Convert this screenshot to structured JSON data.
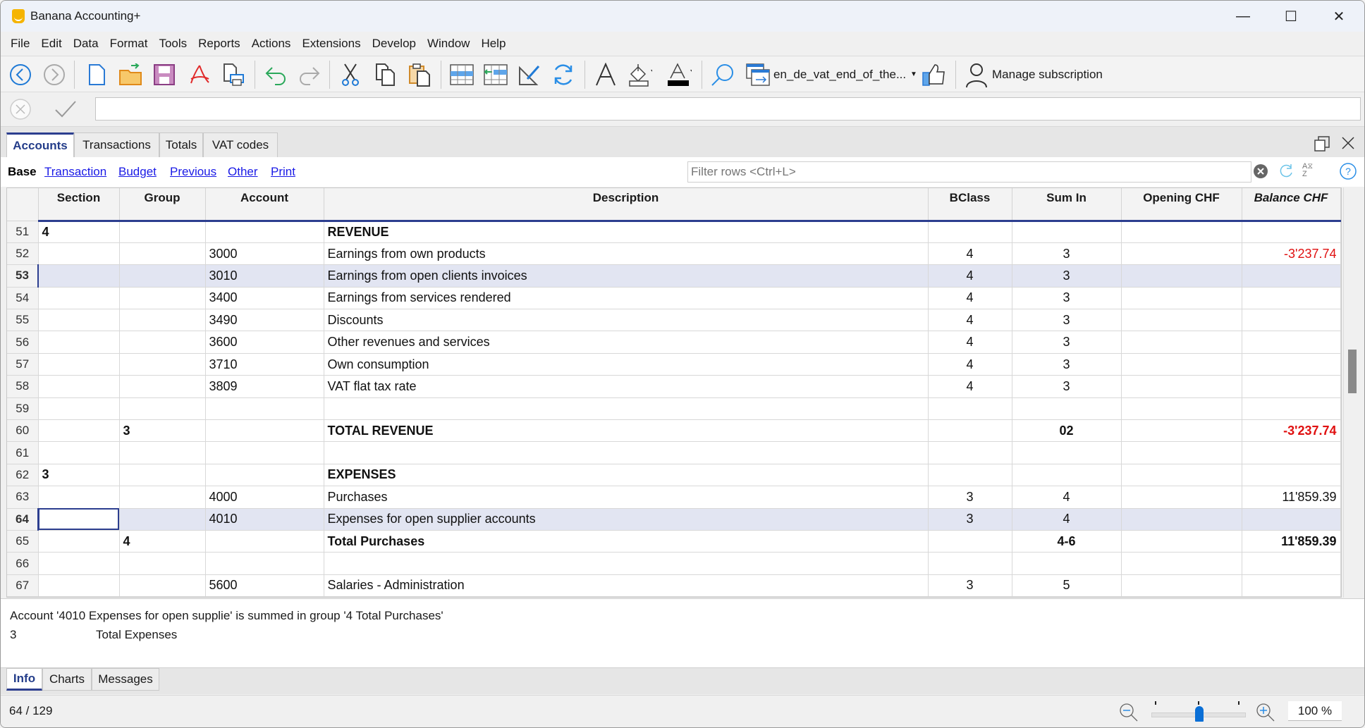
{
  "window": {
    "title": "Banana Accounting+",
    "minimize": "—",
    "maximize": "☐",
    "close": "✕"
  },
  "menu": [
    "File",
    "Edit",
    "Data",
    "Format",
    "Tools",
    "Reports",
    "Actions",
    "Extensions",
    "Develop",
    "Window",
    "Help"
  ],
  "toolbar": {
    "file_selector": "en_de_vat_end_of_the...",
    "manage_subscription": "Manage subscription"
  },
  "editbar": {
    "value": ""
  },
  "tables_tabs": [
    {
      "label": "Accounts",
      "active": true
    },
    {
      "label": "Transactions",
      "active": false
    },
    {
      "label": "Totals",
      "active": false
    },
    {
      "label": "VAT codes",
      "active": false
    }
  ],
  "views": {
    "active": "Base",
    "links": [
      "Transaction",
      "Budget",
      "Previous",
      "Other",
      "Print"
    ]
  },
  "filter": {
    "placeholder": "Filter rows <Ctrl+L>",
    "value": ""
  },
  "columns": [
    "Section",
    "Group",
    "Account",
    "Description",
    "BClass",
    "Sum In",
    "Opening CHF",
    "Balance CHF"
  ],
  "rows": [
    {
      "n": "51",
      "section": "4",
      "group": "",
      "account": "",
      "desc": "REVENUE",
      "bclass": "",
      "sumin": "",
      "opening": "",
      "balance": "",
      "bold": true
    },
    {
      "n": "52",
      "section": "",
      "group": "",
      "account": "3000",
      "desc": "Earnings from own products",
      "bclass": "4",
      "sumin": "3",
      "opening": "",
      "balance": "-3'237.74",
      "neg": true
    },
    {
      "n": "53",
      "section": "",
      "group": "",
      "account": "3010",
      "desc": "Earnings from open clients invoices",
      "bclass": "4",
      "sumin": "3",
      "opening": "",
      "balance": "",
      "highlight": true
    },
    {
      "n": "54",
      "section": "",
      "group": "",
      "account": "3400",
      "desc": "Earnings from services rendered",
      "bclass": "4",
      "sumin": "3",
      "opening": "",
      "balance": ""
    },
    {
      "n": "55",
      "section": "",
      "group": "",
      "account": "3490",
      "desc": "Discounts",
      "bclass": "4",
      "sumin": "3",
      "opening": "",
      "balance": ""
    },
    {
      "n": "56",
      "section": "",
      "group": "",
      "account": "3600",
      "desc": "Other revenues and services",
      "bclass": "4",
      "sumin": "3",
      "opening": "",
      "balance": ""
    },
    {
      "n": "57",
      "section": "",
      "group": "",
      "account": "3710",
      "desc": "Own consumption",
      "bclass": "4",
      "sumin": "3",
      "opening": "",
      "balance": ""
    },
    {
      "n": "58",
      "section": "",
      "group": "",
      "account": "3809",
      "desc": "VAT flat tax rate",
      "bclass": "4",
      "sumin": "3",
      "opening": "",
      "balance": ""
    },
    {
      "n": "59",
      "section": "",
      "group": "",
      "account": "",
      "desc": "",
      "bclass": "",
      "sumin": "",
      "opening": "",
      "balance": ""
    },
    {
      "n": "60",
      "section": "",
      "group": "3",
      "account": "",
      "desc": "TOTAL REVENUE",
      "bclass": "",
      "sumin": "02",
      "opening": "",
      "balance": "-3'237.74",
      "bold": true,
      "neg": true
    },
    {
      "n": "61",
      "section": "",
      "group": "",
      "account": "",
      "desc": "",
      "bclass": "",
      "sumin": "",
      "opening": "",
      "balance": ""
    },
    {
      "n": "62",
      "section": "3",
      "group": "",
      "account": "",
      "desc": "EXPENSES",
      "bclass": "",
      "sumin": "",
      "opening": "",
      "balance": "",
      "bold": true
    },
    {
      "n": "63",
      "section": "",
      "group": "",
      "account": "4000",
      "desc": "Purchases",
      "bclass": "3",
      "sumin": "4",
      "opening": "",
      "balance": "11'859.39"
    },
    {
      "n": "64",
      "section": "",
      "group": "",
      "account": "4010",
      "desc": "Expenses for open supplier accounts",
      "bclass": "3",
      "sumin": "4",
      "opening": "",
      "balance": "",
      "selected": true
    },
    {
      "n": "65",
      "section": "",
      "group": "4",
      "account": "",
      "desc": "Total Purchases",
      "bclass": "",
      "sumin": "4-6",
      "opening": "",
      "balance": "11'859.39",
      "bold": true
    },
    {
      "n": "66",
      "section": "",
      "group": "",
      "account": "",
      "desc": "",
      "bclass": "",
      "sumin": "",
      "opening": "",
      "balance": ""
    },
    {
      "n": "67",
      "section": "",
      "group": "",
      "account": "5600",
      "desc": "Salaries - Administration",
      "bclass": "3",
      "sumin": "5",
      "opening": "",
      "balance": ""
    }
  ],
  "info": {
    "line1": "Account '4010 Expenses for open supplie' is summed in group '4 Total Purchases'",
    "line2_code": "3",
    "line2_text": "Total Expenses"
  },
  "bottom_tabs": [
    {
      "label": "Info",
      "active": true
    },
    {
      "label": "Charts",
      "active": false
    },
    {
      "label": "Messages",
      "active": false
    }
  ],
  "status": {
    "position": "64 / 129",
    "zoom": "100 %",
    "zoom_slider_percent": 50
  },
  "colors": {
    "accent": "#2c3e8f",
    "negative": "#e01010",
    "link": "#1a1ae6",
    "selected_row": "#e2e5f2"
  }
}
